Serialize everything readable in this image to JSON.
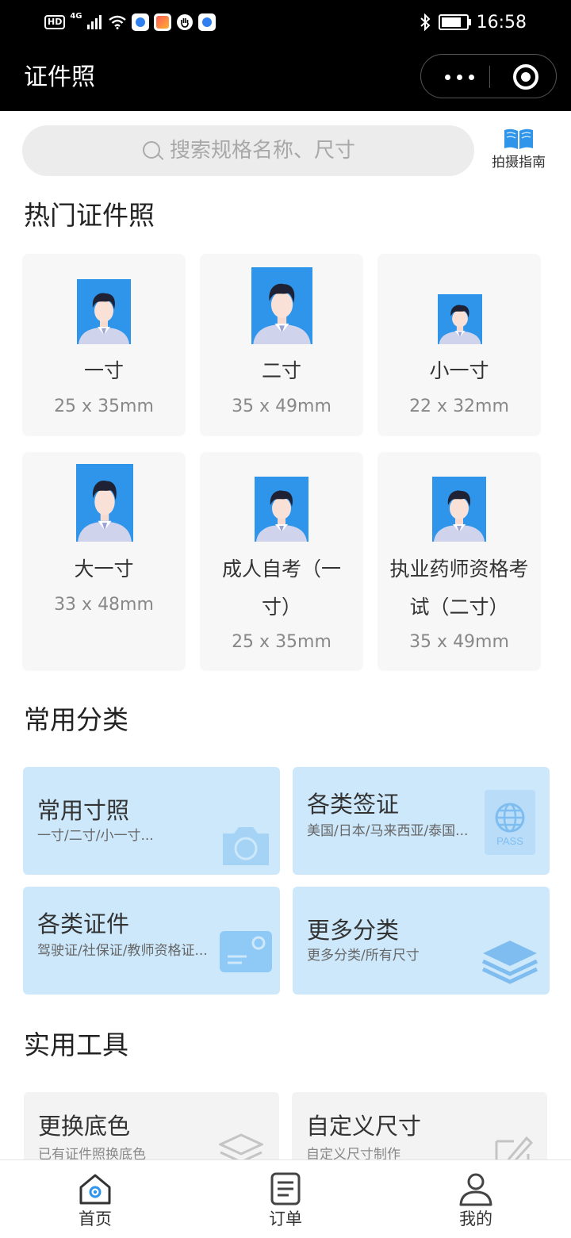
{
  "status_bar": {
    "time": "16:58",
    "network": "4G",
    "hd": "HD"
  },
  "title_bar": {
    "title": "证件照"
  },
  "search": {
    "placeholder": "搜索规格名称、尺寸",
    "guide_label": "拍摄指南"
  },
  "hot": {
    "title": "热门证件照",
    "items": [
      {
        "name": "一寸",
        "size": "25 x 35mm"
      },
      {
        "name": "二寸",
        "size": "35 x 49mm"
      },
      {
        "name": "小一寸",
        "size": "22 x 32mm"
      },
      {
        "name": "大一寸",
        "size": "33 x 48mm"
      },
      {
        "name_line1": "成人自考（一",
        "name_line2": "寸）",
        "size": "25 x 35mm"
      },
      {
        "name_line1": "执业药师资格考",
        "name_line2": "试（二寸）",
        "size": "35 x 49mm"
      }
    ]
  },
  "categories": {
    "title": "常用分类",
    "items": [
      {
        "title": "常用寸照",
        "subtitle": "一寸/二寸/小一寸...",
        "icon": "camera-icon"
      },
      {
        "title": "各类签证",
        "subtitle": "美国/日本/马来西亚/泰国...",
        "icon": "passport-icon",
        "icon_text": "PASS"
      },
      {
        "title": "各类证件",
        "subtitle": "驾驶证/社保证/教师资格证...",
        "icon": "id-card-icon"
      },
      {
        "title": "更多分类",
        "subtitle": "更多分类/所有尺寸",
        "icon": "layers-icon"
      }
    ]
  },
  "tools": {
    "title": "实用工具",
    "items": [
      {
        "title": "更换底色",
        "subtitle": "已有证件照换底色",
        "icon": "layers-outline-icon"
      },
      {
        "title": "自定义尺寸",
        "subtitle": "自定义尺寸制作",
        "icon": "edit-icon"
      }
    ]
  },
  "tabbar": {
    "items": [
      {
        "label": "首页",
        "icon": "home-icon",
        "active": true
      },
      {
        "label": "订单",
        "icon": "order-icon",
        "active": false
      },
      {
        "label": "我的",
        "icon": "user-icon",
        "active": false
      }
    ]
  },
  "colors": {
    "accent": "#2f95ea",
    "card_blue": "#cde8fb",
    "title_bar": "#000000"
  }
}
